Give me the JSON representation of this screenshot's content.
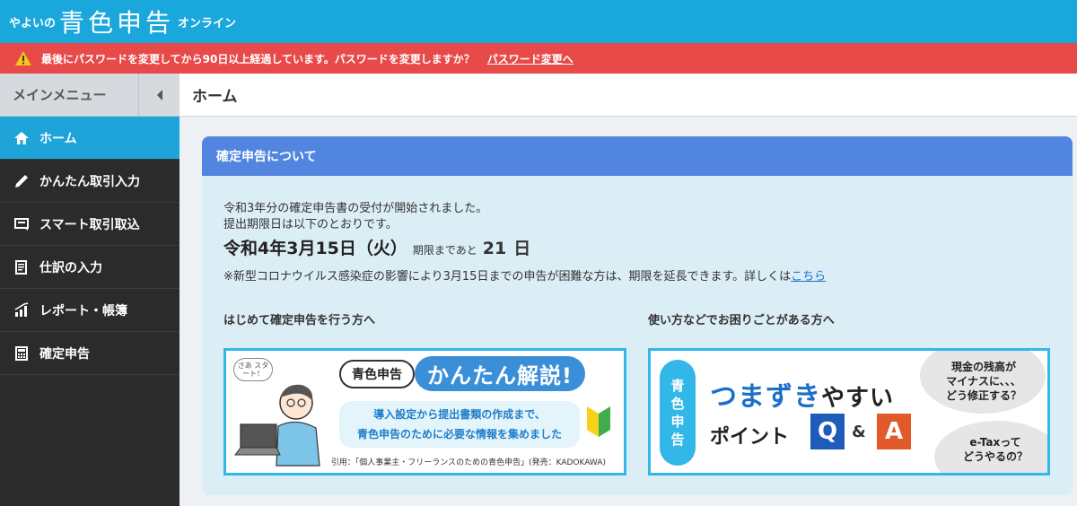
{
  "header": {
    "logo_prefix": "やよいの",
    "logo_main": "青色申告",
    "logo_suffix": "オンライン"
  },
  "alert": {
    "message": "最後にパスワードを変更してから90日以上経過しています。パスワードを変更しますか？",
    "link": "パスワード変更へ",
    "icon": "warning-icon"
  },
  "sidebar": {
    "heading": "メインメニュー",
    "collapse_icon": "chevron-left-icon",
    "items": [
      {
        "label": "ホーム",
        "icon": "home-icon",
        "active": true
      },
      {
        "label": "かんたん取引入力",
        "icon": "pencil-icon",
        "active": false
      },
      {
        "label": "スマート取引取込",
        "icon": "import-icon",
        "active": false
      },
      {
        "label": "仕訳の入力",
        "icon": "journal-icon",
        "active": false
      },
      {
        "label": "レポート・帳簿",
        "icon": "chart-icon",
        "active": false
      },
      {
        "label": "確定申告",
        "icon": "calculator-icon",
        "active": false
      }
    ]
  },
  "main": {
    "title": "ホーム",
    "panel": {
      "title": "確定申告について",
      "line1": "令和3年分の確定申告書の受付が開始されました。",
      "line2": "提出期限日は以下のとおりです。",
      "deadline": "令和4年3月15日（火）",
      "remaining_label": "期限まであと",
      "remaining_days": "21",
      "remaining_unit": "日",
      "note": "※新型コロナウイルス感染症の影響により3月15日までの申告が困難な方は、期限を延長できます。詳しくは",
      "note_link": "こちら",
      "left_title": "はじめて確定申告を行う方へ",
      "right_title": "使い方などでお困りごとがある方へ",
      "banner_left": {
        "sticker": "さあ スタート！",
        "badge": "青色申告",
        "title": "かんたん解説!",
        "line1": "導入設定から提出書類の作成まで、",
        "line2": "青色申告のために必要な情報を集めました",
        "citation": "引用：「個人事業主・フリーランスのための青色申告」(発売：KADOKAWA)"
      },
      "banner_right": {
        "tag": [
          "青",
          "色",
          "申",
          "告"
        ],
        "title_a": "つまずき",
        "title_b": "やすい",
        "sub": "ポイント",
        "q": "Q",
        "amp": "&",
        "a": "A",
        "bubble1": [
          "現金の残高が",
          "マイナスに、、、",
          "どう修正する？"
        ],
        "bubble2": [
          "e-Taxって",
          "どうやるの？"
        ]
      }
    }
  },
  "colors": {
    "header": "#1aa7dc",
    "alert": "#e84a4a",
    "sidebar": "#2b2b2b",
    "active": "#1ea4d9",
    "panel_head": "#5285e0",
    "panel_bg": "#dbeef6"
  }
}
